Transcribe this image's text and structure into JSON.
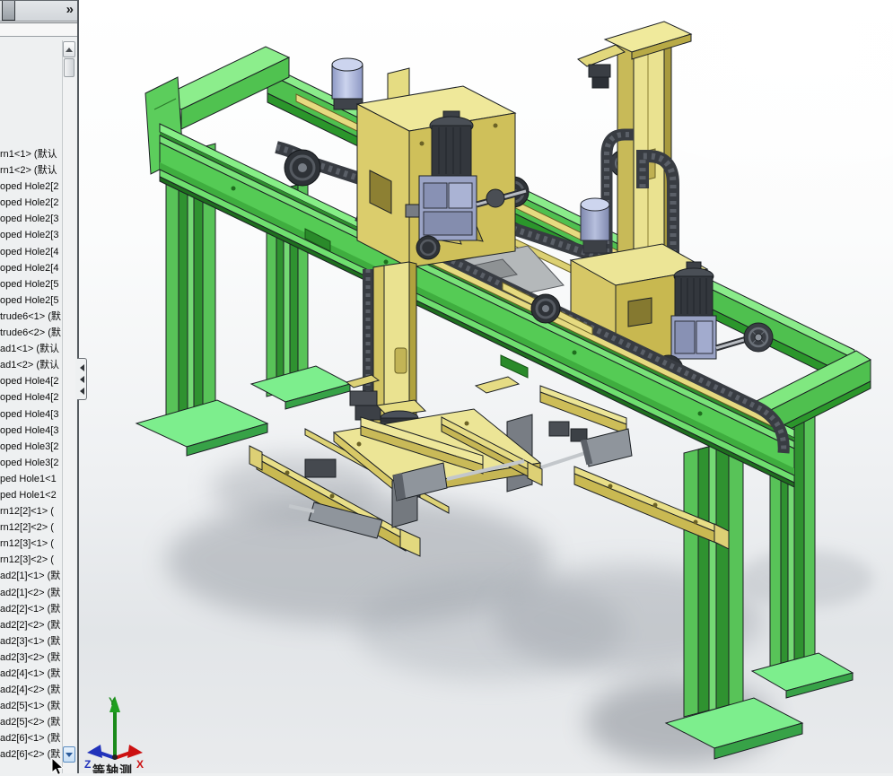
{
  "panel": {
    "expand_chevron": "»",
    "tree_items": [
      "rn1<1> (默认",
      "rn1<2> (默认",
      "oped Hole2[2",
      "oped Hole2[2",
      "oped Hole2[3",
      "oped Hole2[3",
      "oped Hole2[4",
      "oped Hole2[4",
      "oped Hole2[5",
      "oped Hole2[5",
      "trude6<1> (默",
      "trude6<2> (默",
      "ad1<1> (默认",
      "ad1<2> (默认",
      "oped Hole4[2",
      "oped Hole4[2",
      "oped Hole4[3",
      "oped Hole4[3",
      "oped Hole3[2",
      "oped Hole3[2",
      "ped Hole1<1",
      "ped Hole1<2",
      "rn12[2]<1> (",
      "rn12[2]<2> (",
      "rn12[3]<1> (",
      "rn12[3]<2> (",
      "ad2[1]<1> (默",
      "ad2[1]<2> (默",
      "ad2[2]<1> (默",
      "ad2[2]<2> (默",
      "ad2[3]<1> (默",
      "ad2[3]<2> (默",
      "ad2[4]<1> (默",
      "ad2[4]<2> (默",
      "ad2[5]<1> (默",
      "ad2[5]<2> (默",
      "ad2[6]<1> (默",
      "ad2[6]<2> (默"
    ]
  },
  "viewport": {
    "view_label": "等轴测",
    "triad": {
      "x": "X",
      "y": "Y",
      "z": "Z"
    },
    "colors": {
      "frame_green_top": "#86ef86",
      "frame_green_web": "#55cb55",
      "frame_green_dark": "#2b962b",
      "part_yellow_light": "#ece596",
      "part_yellow_dark": "#c9ba58",
      "chain_dark": "#383c42",
      "motor_blue": "#a9b2d6",
      "steel_gray": "#8f959c"
    }
  }
}
